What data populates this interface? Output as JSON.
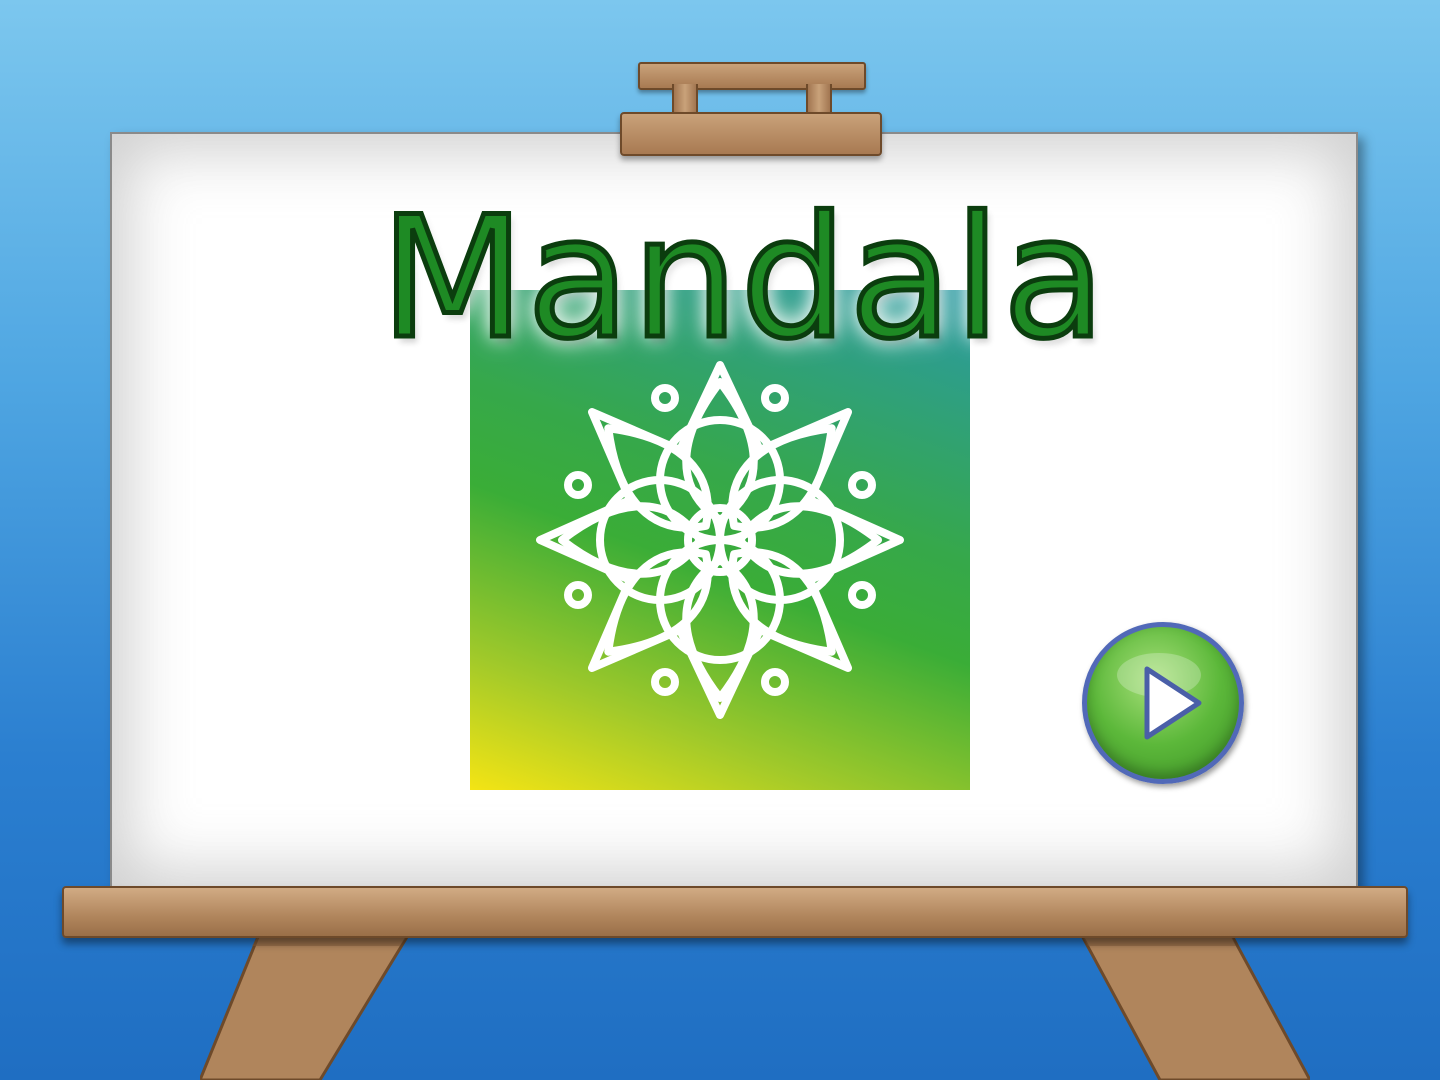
{
  "title": "Mandala",
  "icons": {
    "mandala": "mandala-icon",
    "play": "play-icon"
  },
  "colors": {
    "background_top": "#7cc7ee",
    "background_bottom": "#1f6ec2",
    "title_fill": "#1e8a24",
    "title_outline": "#0b3d0e",
    "wood": "#b0855c",
    "play_button": "#5cb83a",
    "play_button_ring": "#5169b8"
  }
}
